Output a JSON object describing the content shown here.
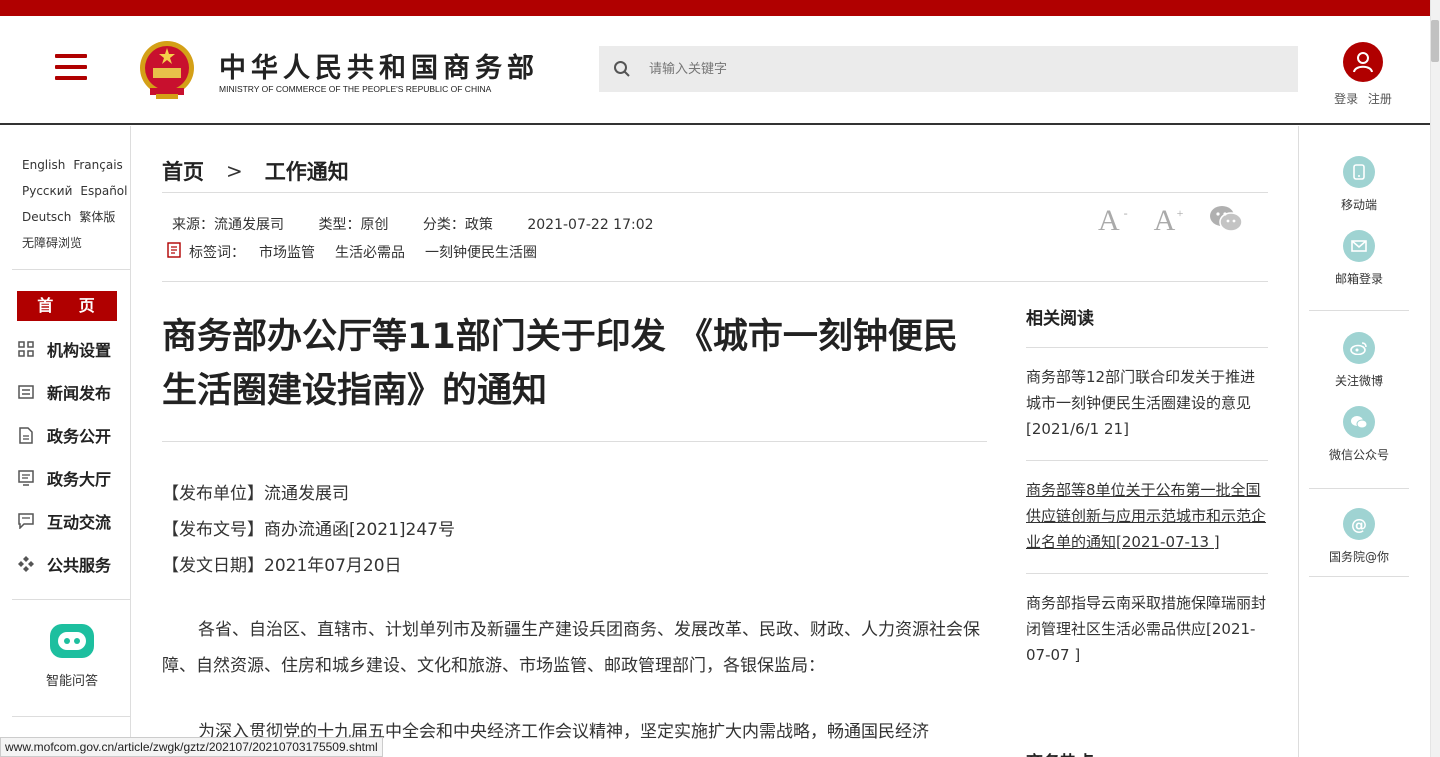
{
  "header": {
    "logo_cn": "中华人民共和国商务部",
    "logo_en": "MINISTRY OF COMMERCE OF THE PEOPLE'S REPUBLIC OF CHINA",
    "search_placeholder": "请输入关键字",
    "login": "登录",
    "register": "注册"
  },
  "left_nav": {
    "languages": [
      "English",
      "Français",
      "Русский",
      "Español",
      "Deutsch",
      "繁体版",
      "无障碍浏览"
    ],
    "home": "首 页",
    "items": [
      "机构设置",
      "新闻发布",
      "政务公开",
      "政务大厅",
      "互动交流",
      "公共服务"
    ],
    "ai_label": "智能问答"
  },
  "breadcrumb": {
    "home": "首页",
    "separator": ">",
    "current": "工作通知"
  },
  "meta": {
    "source": "来源：流通发展司",
    "type": "类型：原创",
    "category": "分类：政策",
    "datetime": "2021-07-22 17:02",
    "tags_label": "标签词：",
    "tags": [
      "市场监管",
      "生活必需品",
      "一刻钟便民生活圈"
    ]
  },
  "tools": {
    "font_down": "A",
    "font_up": "A",
    "minus": "-",
    "plus": "+"
  },
  "article": {
    "title": "商务部办公厅等11部门关于印发 《城市一刻钟便民生活圈建设指南》的通知",
    "fields": [
      "【发布单位】流通发展司",
      "【发布文号】商办流通函[2021]247号",
      "【发文日期】2021年07月20日"
    ],
    "para1": "各省、自治区、直辖市、计划单列市及新疆生产建设兵团商务、发展改革、民政、财政、人力资源社会保障、自然资源、住房和城乡建设、文化和旅游、市场监管、邮政管理部门，各银保监局：",
    "para2": "为深入贯彻党的十九届五中全会和中央经济工作会议精神，坚定实施扩大内需战略，畅通国民经济"
  },
  "related": {
    "heading": "相关阅读",
    "items": [
      "商务部等12部门联合印发关于推进城市一刻钟便民生活圈建设的意见[2021/6/1 21]",
      "商务部等8单位关于公布第一批全国供应链创新与应用示范城市和示范企业名单的通知[2021-07-13 ]",
      "商务部指导云南采取措施保障瑞丽封闭管理社区生活必需品供应[2021-07-07 ]"
    ],
    "next_heading": "商务热点"
  },
  "right_bar": {
    "items": [
      "移动端",
      "邮箱登录",
      "关注微博",
      "微信公众号",
      "国务院@你"
    ],
    "at_symbol": "@"
  },
  "status_url": "www.mofcom.gov.cn/article/zwgk/gztz/202107/20210703175509.shtml",
  "colors": {
    "brand_red": "#b00000",
    "teal": "#9fd3d2",
    "ai_green": "#1dbf9f"
  }
}
